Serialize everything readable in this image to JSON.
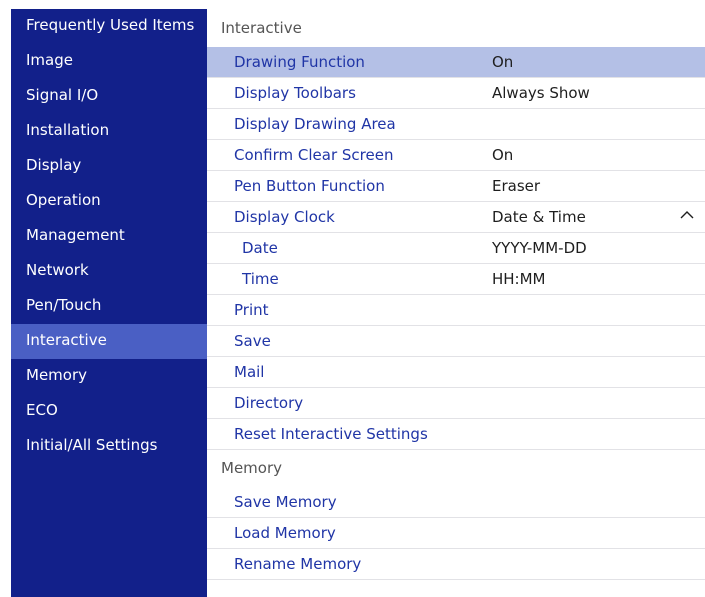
{
  "sidebar": {
    "items": [
      {
        "label": "Frequently Used Items"
      },
      {
        "label": "Image"
      },
      {
        "label": "Signal I/O"
      },
      {
        "label": "Installation"
      },
      {
        "label": "Display"
      },
      {
        "label": "Operation"
      },
      {
        "label": "Management"
      },
      {
        "label": "Network"
      },
      {
        "label": "Pen/Touch"
      },
      {
        "label": "Interactive",
        "selected": true
      },
      {
        "label": "Memory"
      },
      {
        "label": "ECO"
      },
      {
        "label": "Initial/All Settings"
      }
    ]
  },
  "content": {
    "interactive_section": {
      "header": "Interactive",
      "rows": [
        {
          "label": "Drawing Function",
          "value": "On",
          "selected": true
        },
        {
          "label": "Display Toolbars",
          "value": "Always Show"
        },
        {
          "label": "Display Drawing Area",
          "value": ""
        },
        {
          "label": "Confirm Clear Screen",
          "value": "On"
        },
        {
          "label": "Pen Button Function",
          "value": "Eraser"
        },
        {
          "label": "Display Clock",
          "value": "Date & Time",
          "expanded": true,
          "chevron_icon": "chevron-up-icon"
        },
        {
          "label": "Date",
          "value": "YYYY-MM-DD",
          "sub": true
        },
        {
          "label": "Time",
          "value": "HH:MM",
          "sub": true
        },
        {
          "label": "Print",
          "value": ""
        },
        {
          "label": "Save",
          "value": ""
        },
        {
          "label": "Mail",
          "value": ""
        },
        {
          "label": "Directory",
          "value": ""
        },
        {
          "label": "Reset Interactive Settings",
          "value": ""
        }
      ]
    },
    "memory_section": {
      "header": "Memory",
      "rows": [
        {
          "label": "Save Memory"
        },
        {
          "label": "Load Memory"
        },
        {
          "label": "Rename Memory"
        }
      ]
    }
  },
  "colors": {
    "sidebar_bg": "#12208a",
    "sidebar_selected": "#4a5fc4",
    "row_selected": "#b4c0e6",
    "label_text": "#2035a6"
  }
}
